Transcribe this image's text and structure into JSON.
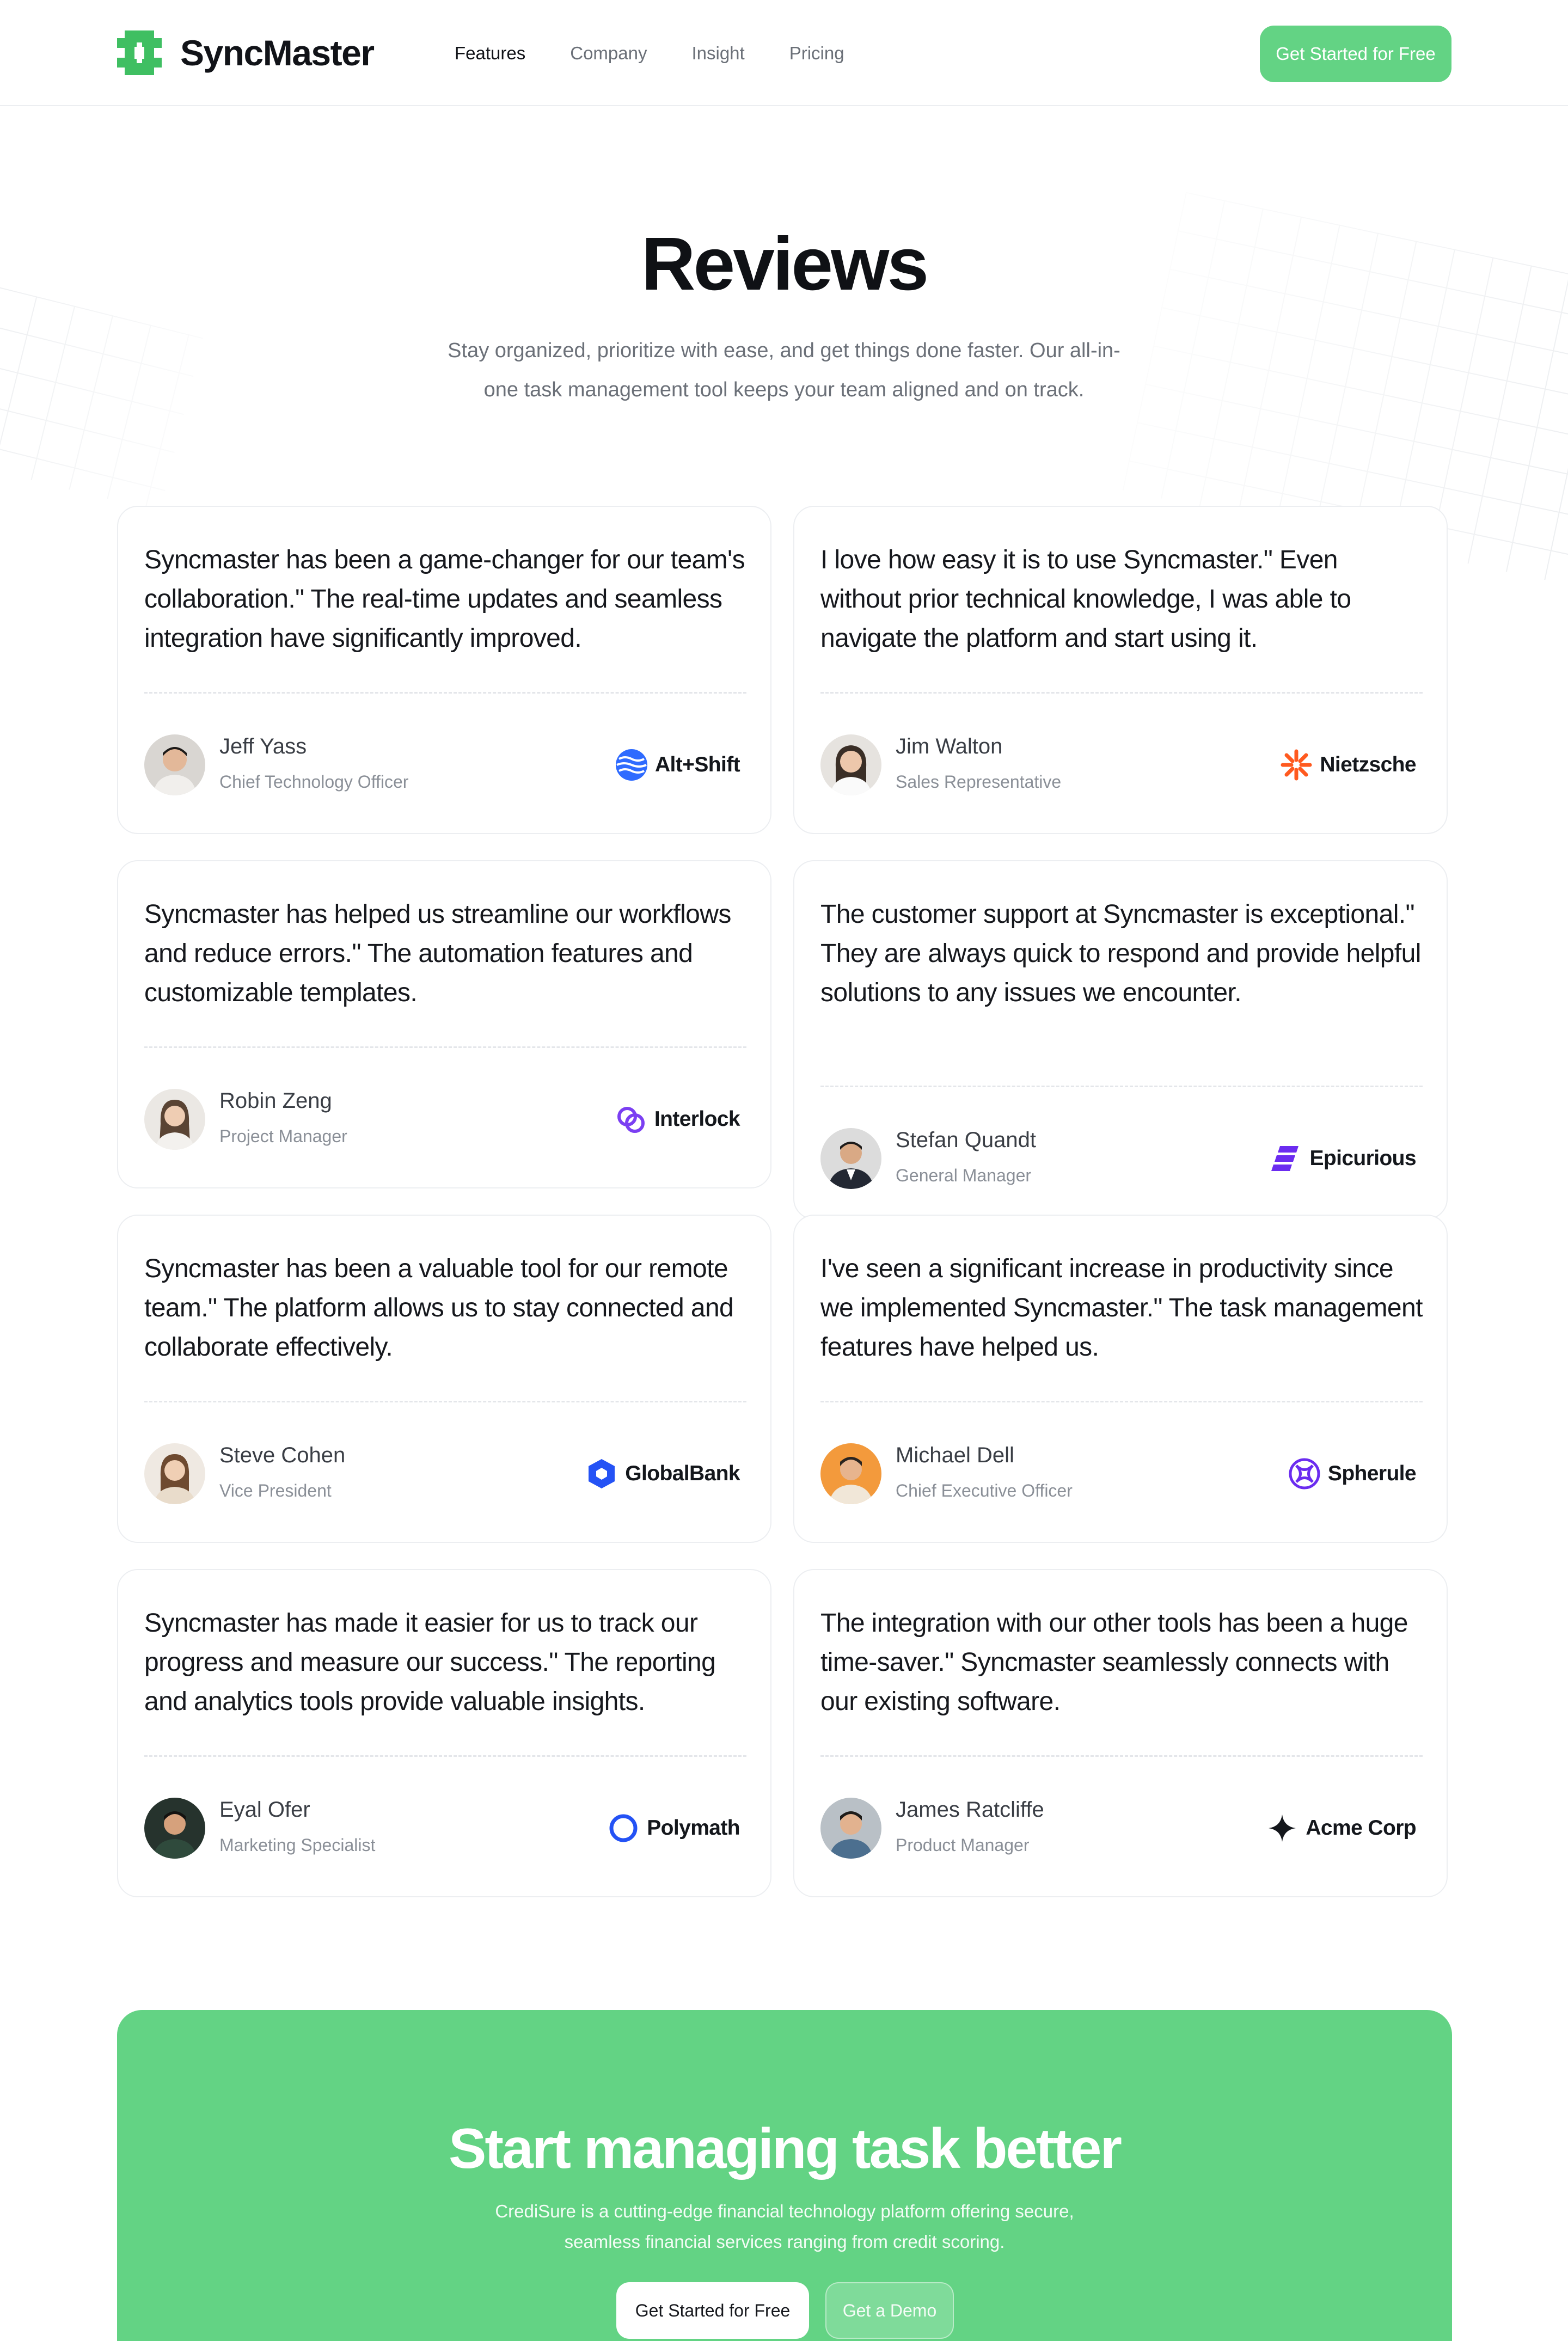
{
  "colors": {
    "brand_green": "#63d384",
    "text_dark": "#0f1115",
    "text_muted": "#6b7078"
  },
  "nav": {
    "brand": "SyncMaster",
    "links": [
      "Features",
      "Company",
      "Insight",
      "Pricing"
    ],
    "active": "Features",
    "cta": "Get Started for Free"
  },
  "hero": {
    "title": "Reviews",
    "subtitle": "Stay organized, prioritize with ease, and get things done faster. Our all-in-one task management tool keeps your team aligned and on track."
  },
  "reviews": [
    {
      "quote": "Syncmaster has been a game-changer for our team's collaboration.\" The real-time updates and seamless integration have significantly improved.",
      "name": "Jeff Yass",
      "role": "Chief Technology Officer",
      "company": "Alt+Shift",
      "company_icon": "waves-icon"
    },
    {
      "quote": "I love how easy it is to use Syncmaster.\" Even without prior technical knowledge, I was able to navigate the platform and start using it.",
      "name": "Jim Walton",
      "role": "Sales Representative",
      "company": "Nietzsche",
      "company_icon": "sunburst-icon"
    },
    {
      "quote": "Syncmaster has helped us streamline our workflows and reduce errors.\" The automation features and customizable templates.",
      "name": "Robin Zeng",
      "role": "Project Manager",
      "company": "Interlock",
      "company_icon": "interlocking-rings-icon"
    },
    {
      "quote": "The customer support at Syncmaster is exceptional.\" They are always quick to respond and provide helpful solutions to any issues we encounter.",
      "name": "Stefan Quandt",
      "role": "General Manager",
      "company": "Epicurious",
      "company_icon": "stacked-bars-icon"
    },
    {
      "quote": "Syncmaster has been a valuable tool for our remote team.\" The platform allows us to stay connected and collaborate effectively.",
      "name": "Steve Cohen",
      "role": "Vice President",
      "company": "GlobalBank",
      "company_icon": "hexagon-icon"
    },
    {
      "quote": "I've seen a significant increase in productivity since we implemented Syncmaster.\" The task management features have helped us.",
      "name": "Michael Dell",
      "role": "Chief Executive Officer",
      "company": "Spherule",
      "company_icon": "sphere-icon"
    },
    {
      "quote": "Syncmaster has made it easier for us to track our progress and measure our success.\" The reporting and analytics tools provide valuable insights.",
      "name": "Eyal Ofer",
      "role": "Marketing Specialist",
      "company": "Polymath",
      "company_icon": "ring-icon"
    },
    {
      "quote": "The integration with our other tools has been a huge time-saver.\" Syncmaster seamlessly connects with our existing software.",
      "name": "James Ratcliffe",
      "role": "Product Manager",
      "company": "Acme Corp",
      "company_icon": "sparkle-icon"
    }
  ],
  "cta": {
    "title": "Start managing task better",
    "subtitle": "CrediSure is a cutting-edge financial technology platform offering secure, seamless financial services ranging from credit scoring.",
    "primary": "Get Started for Free",
    "secondary": "Get a Demo"
  }
}
